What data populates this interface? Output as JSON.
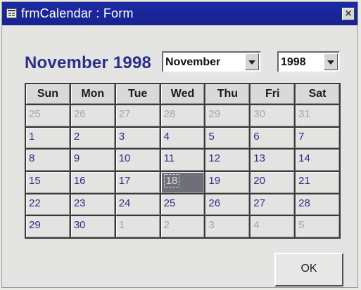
{
  "window": {
    "title": "frmCalendar : Form",
    "close_label": "×"
  },
  "heading": {
    "text": "November 1998"
  },
  "month_select": {
    "value": "November"
  },
  "year_select": {
    "value": "1998"
  },
  "calendar": {
    "weekdays": [
      "Sun",
      "Mon",
      "Tue",
      "Wed",
      "Thu",
      "Fri",
      "Sat"
    ],
    "days": [
      {
        "label": "25",
        "current": false
      },
      {
        "label": "26",
        "current": false
      },
      {
        "label": "27",
        "current": false
      },
      {
        "label": "28",
        "current": false
      },
      {
        "label": "29",
        "current": false
      },
      {
        "label": "30",
        "current": false
      },
      {
        "label": "31",
        "current": false
      },
      {
        "label": "1",
        "current": true
      },
      {
        "label": "2",
        "current": true
      },
      {
        "label": "3",
        "current": true
      },
      {
        "label": "4",
        "current": true
      },
      {
        "label": "5",
        "current": true
      },
      {
        "label": "6",
        "current": true
      },
      {
        "label": "7",
        "current": true
      },
      {
        "label": "8",
        "current": true
      },
      {
        "label": "9",
        "current": true
      },
      {
        "label": "10",
        "current": true
      },
      {
        "label": "11",
        "current": true
      },
      {
        "label": "12",
        "current": true
      },
      {
        "label": "13",
        "current": true
      },
      {
        "label": "14",
        "current": true
      },
      {
        "label": "15",
        "current": true
      },
      {
        "label": "16",
        "current": true
      },
      {
        "label": "17",
        "current": true
      },
      {
        "label": "18",
        "current": true,
        "selected": true
      },
      {
        "label": "19",
        "current": true
      },
      {
        "label": "20",
        "current": true
      },
      {
        "label": "21",
        "current": true
      },
      {
        "label": "22",
        "current": true
      },
      {
        "label": "23",
        "current": true
      },
      {
        "label": "24",
        "current": true
      },
      {
        "label": "25",
        "current": true
      },
      {
        "label": "26",
        "current": true
      },
      {
        "label": "27",
        "current": true
      },
      {
        "label": "28",
        "current": true
      },
      {
        "label": "29",
        "current": true
      },
      {
        "label": "30",
        "current": true
      },
      {
        "label": "1",
        "current": false
      },
      {
        "label": "2",
        "current": false
      },
      {
        "label": "3",
        "current": false
      },
      {
        "label": "4",
        "current": false
      },
      {
        "label": "5",
        "current": false
      }
    ]
  },
  "ok_button": {
    "label": "OK"
  },
  "colors": {
    "titlebar": "#1c2aa3",
    "heading": "#2c2e8c",
    "day_text": "#2c2e8c",
    "other_month_text": "#a5a5ad",
    "selected_day_bg": "#6f6f7a"
  },
  "icons": {
    "title_icon": "form-icon",
    "close": "close-icon",
    "dropdown": "chevron-down-icon"
  }
}
